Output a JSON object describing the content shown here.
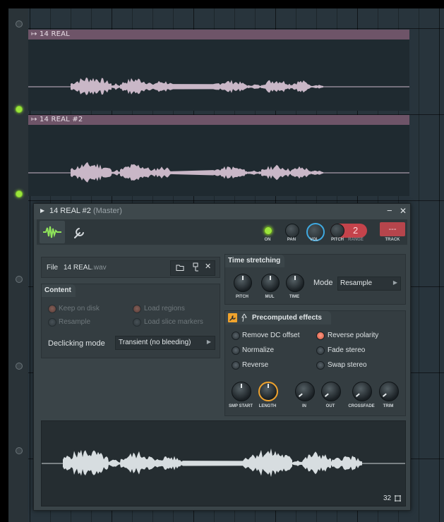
{
  "playlist": {
    "clips": [
      {
        "label": "14 REAL"
      },
      {
        "label": "14 REAL #2"
      }
    ]
  },
  "window": {
    "title": "14 REAL #2",
    "title_suffix": "(Master)",
    "minimize": "−",
    "close": "✕",
    "toolbar": {
      "on_label": "ON",
      "pan_label": "PAN",
      "vol_label": "VOL",
      "pitch_label": "PITCH",
      "range_label": "RANGE",
      "range_value": "2",
      "track_label": "TRACK",
      "track_value": "---"
    },
    "file": {
      "label": "File",
      "name": "14 REAL",
      "ext": ".wav"
    },
    "content": {
      "tab": "Content",
      "keep_on_disk": "Keep on disk",
      "resample": "Resample",
      "load_regions": "Load regions",
      "load_slice_markers": "Load slice markers",
      "declicking_label": "Declicking mode",
      "declicking_value": "Transient (no bleeding)"
    },
    "time_stretching": {
      "tab": "Time stretching",
      "pitch": "PITCH",
      "mul": "MUL",
      "time": "TIME",
      "mode_label": "Mode",
      "mode_value": "Resample"
    },
    "precomputed": {
      "tab": "Precomputed effects",
      "remove_dc": "Remove DC offset",
      "normalize": "Normalize",
      "reverse": "Reverse",
      "reverse_polarity": "Reverse polarity",
      "fade_stereo": "Fade stereo",
      "swap_stereo": "Swap stereo",
      "knobs": [
        "SMP START",
        "LENGTH",
        "IN",
        "OUT",
        "CROSSFADE",
        "TRIM"
      ]
    },
    "waveform": {
      "zoom": "32"
    }
  },
  "colors": {
    "accent_on": "#9be53b",
    "active_radio": "#e0644a",
    "clip": "#6e5468",
    "wave": "#c9b7c7",
    "length_knob": "#f0a32d",
    "vol_knob": "#3fa9e0"
  }
}
